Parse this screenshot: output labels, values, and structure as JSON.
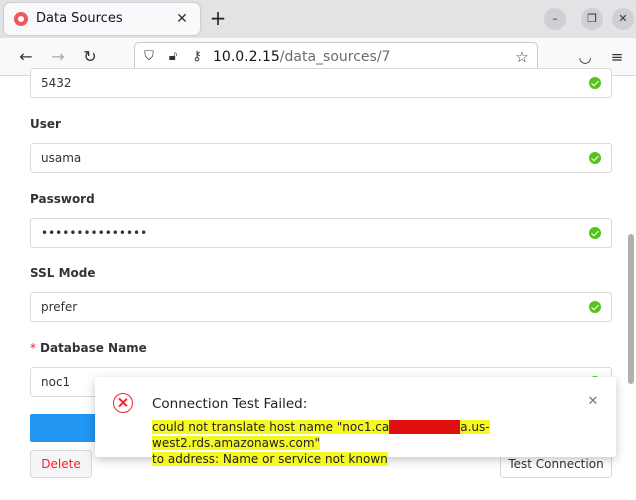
{
  "browser": {
    "tab_title": "Data Sources",
    "url_host": "10.0.2.15",
    "url_path": "/data_sources/7"
  },
  "form": {
    "port_value": "5432",
    "user_label": "User",
    "user_value": "usama",
    "password_label": "Password",
    "password_value": "•••••••••••••••",
    "ssl_label": "SSL Mode",
    "ssl_value": "prefer",
    "dbname_label": "Database Name",
    "dbname_required": "*",
    "dbname_value": "noc1"
  },
  "buttons": {
    "delete_label": "Delete",
    "test_label": "Test Connection"
  },
  "notification": {
    "title": "Connection Test Failed:",
    "msg_part1": "could not translate host name \"noc1.ca",
    "msg_redacted": "xxxxxxxxxx",
    "msg_part2": "a.us-west2.rds.amazonaws.com\"",
    "msg_line2": "to address: Name or service not known"
  },
  "icons": {
    "tab_close": "close-icon",
    "new_tab": "plus-icon",
    "back": "arrow-left-icon",
    "forward": "arrow-right-icon",
    "reload": "reload-icon",
    "shield": "shield-icon",
    "lock": "lock-icon",
    "key": "key-icon",
    "star": "star-icon",
    "pocket": "pocket-icon",
    "menu": "hamburger-menu-icon",
    "check": "check-circle-icon",
    "error": "error-circle-icon"
  },
  "colors": {
    "accent": "#2196f3",
    "success": "#52c41a",
    "error": "#f5222d",
    "highlight": "#f7f722"
  }
}
